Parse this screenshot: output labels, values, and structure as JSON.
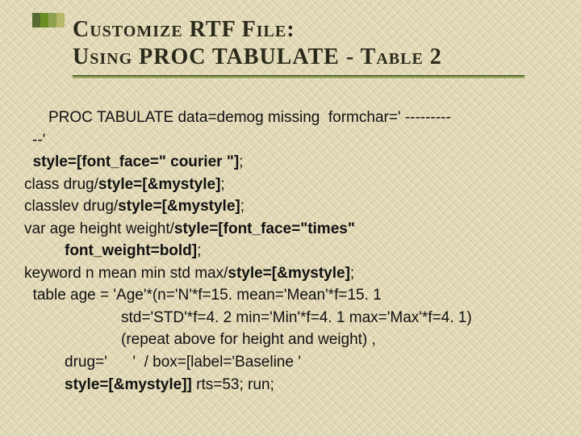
{
  "title": {
    "line1": "Customize RTF File:",
    "line2": "Using PROC TABULATE - Table 2"
  },
  "code": {
    "l1a": "PROC TABULATE data=demog missing  formchar=' ---------",
    "l1b": "--'",
    "l2a": "  style=[font_face=\" courier \"]",
    "l2b": ";",
    "l3a": "class drug/",
    "l3b": "style=[&mystyle]",
    "l3c": ";",
    "l4a": "classlev drug/",
    "l4b": "style=[&mystyle]",
    "l4c": ";",
    "l5a": "var age height weight/",
    "l5b": "style=[font_face=\"times\"",
    "l5c": "font_weight=bold]",
    "l5d": ";",
    "l6a": "keyword n mean min std max/",
    "l6b": "style=[&mystyle]",
    "l6c": ";",
    "l7": "  table age = 'Age'*(n='N'*f=15. mean='Mean'*f=15. 1",
    "l8": "std='STD'*f=4. 2 min='Min'*f=4. 1 max='Max'*f=4. 1)",
    "l9": "(repeat above for height and weight) ,",
    "l10": "drug='      '  / box=[label='Baseline '",
    "l11a": "style=[&mystyle]]",
    "l11b": " rts=53; run;"
  }
}
